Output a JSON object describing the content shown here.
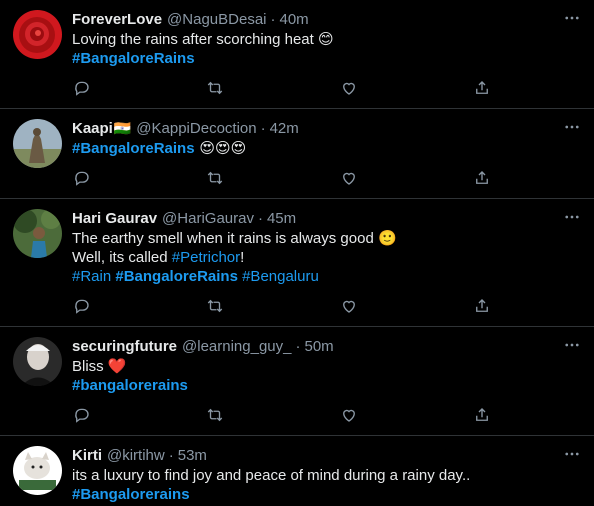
{
  "tweets": [
    {
      "name": "ForeverLove",
      "flag": "",
      "handle": "@NaguBDesai",
      "sep": "·",
      "time": "40m",
      "lines": [
        {
          "pre": "Loving the rains after scorching heat ",
          "emoji": "😊"
        },
        {
          "tag": "#BangaloreRains"
        }
      ]
    },
    {
      "name": "Kaapi",
      "flag": "🇮🇳",
      "handle": "@KappiDecoction",
      "sep": "·",
      "time": "42m",
      "lines": [
        {
          "tag": "#BangaloreRains",
          "emoji": " 😍😍😍"
        }
      ]
    },
    {
      "name": "Hari Gaurav",
      "flag": "",
      "handle": "@HariGaurav",
      "sep": "·",
      "time": "45m",
      "lines": [
        {
          "pre": "The earthy smell when it rains is always good ",
          "emoji": "🙂"
        },
        {
          "pre": "Well, its called ",
          "tag": "#Petrichor",
          "post": "!"
        },
        {
          "tags": [
            "#Rain",
            "#BangaloreRains",
            "#Bengaluru"
          ]
        }
      ]
    },
    {
      "name": "securingfuture",
      "flag": "",
      "handle": "@learning_guy_",
      "sep": "·",
      "time": "50m",
      "lines": [
        {
          "pre": "Bliss ",
          "emoji": "❤️"
        },
        {
          "tag": "#bangalorerains"
        }
      ]
    },
    {
      "name": "Kirti",
      "flag": "",
      "handle": "@kirtihw",
      "sep": "·",
      "time": "53m",
      "lines": [
        {
          "pre": "its a luxury to find joy and peace of mind during a rainy day.."
        },
        {
          "tag": "#Bangalorerains"
        }
      ]
    }
  ],
  "icons": {
    "more": "more-horizontal-icon",
    "reply": "reply-icon",
    "retweet": "retweet-icon",
    "like": "like-icon",
    "share": "share-icon"
  },
  "colors": {
    "background": "#000000",
    "text": "#e7e9ea",
    "secondary": "#8b98a5",
    "link": "#1d9bf0",
    "divider": "#2f3336"
  }
}
